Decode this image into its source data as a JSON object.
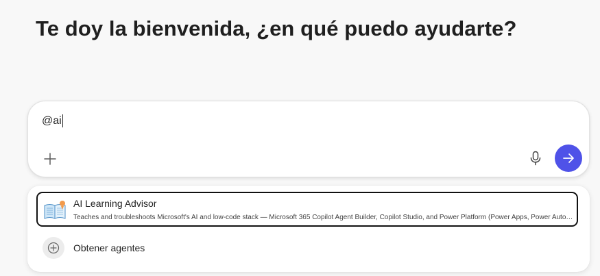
{
  "greeting": "Te doy la bienvenida, ¿en qué puedo ayudarte?",
  "composer": {
    "input_value": "@ai",
    "add_icon": "plus-icon",
    "mic_icon": "microphone-icon",
    "send_icon": "arrow-right-icon",
    "send_color": "#4f52e8"
  },
  "suggestions": {
    "agents": [
      {
        "name": "AI Learning Advisor",
        "description": "Teaches and troubleshoots Microsoft's AI and low-code stack — Microsoft 365 Copilot Agent Builder, Copilot Studio, and Power Platform (Power Apps, Power Automate, Power BI)",
        "icon": "open-book-icon"
      }
    ],
    "get_agents_label": "Obtener agentes",
    "get_agents_icon": "plus-circle-icon"
  }
}
